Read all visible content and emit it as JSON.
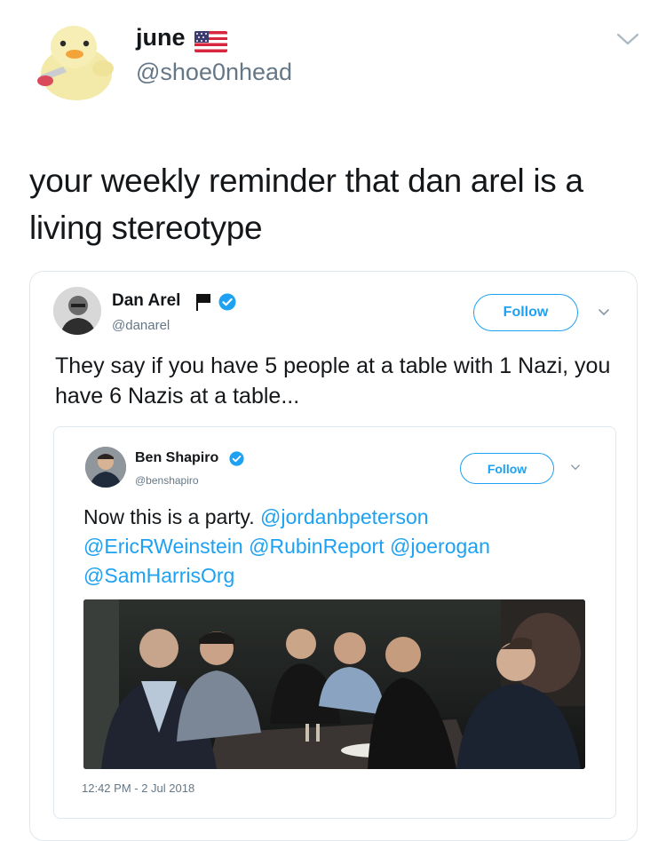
{
  "outer": {
    "name": "june",
    "handle": "@shoe0nhead",
    "text": "your weekly reminder that dan arel is a living stereotype"
  },
  "quoted": {
    "name": "Dan Arel",
    "handle": "@danarel",
    "follow_label": "Follow",
    "text": "They say if you have 5 people at a table with 1 Nazi, you have 6 Nazis at a table..."
  },
  "nested": {
    "name": "Ben Shapiro",
    "handle": "@benshapiro",
    "follow_label": "Follow",
    "text_plain": "Now this is a party. ",
    "mentions": [
      "@jordanbpeterson",
      "@EricRWeinstein",
      "@RubinReport",
      "@joerogan",
      "@SamHarrisOrg"
    ],
    "timestamp": "12:42 PM - 2 Jul 2018"
  },
  "colors": {
    "accent": "#1da1f2",
    "text": "#14171a",
    "secondary": "#657786",
    "border": "#e1e8ed"
  }
}
